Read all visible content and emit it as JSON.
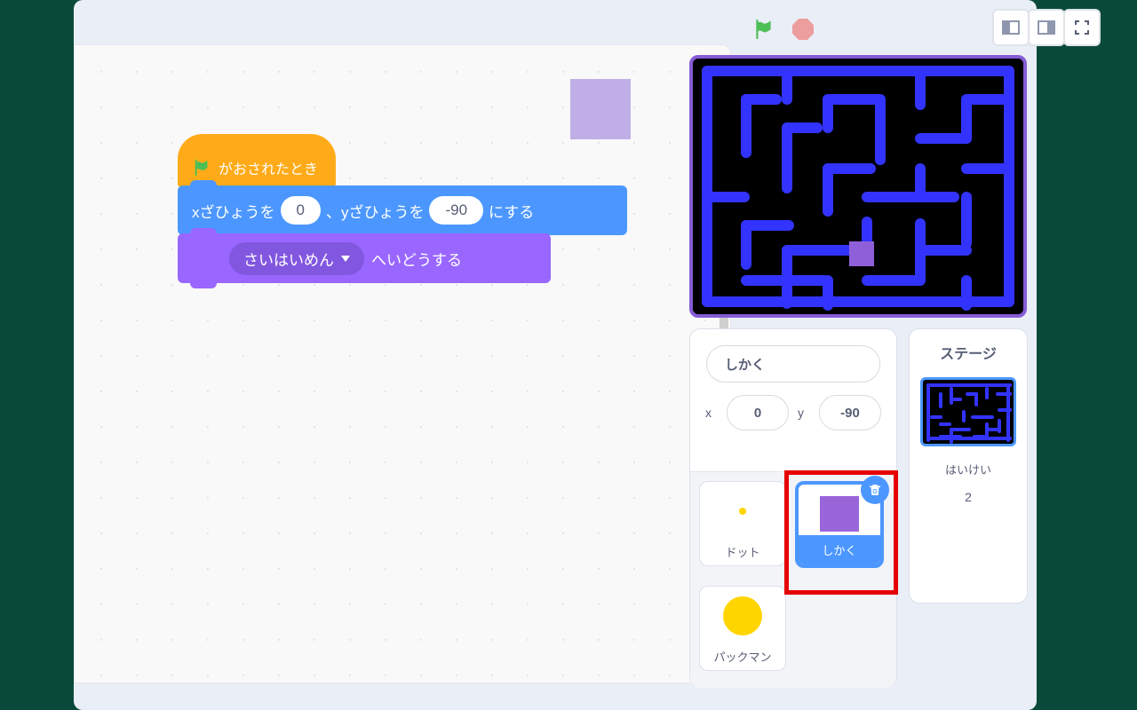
{
  "blocks": {
    "hat_label": "がおされたとき",
    "motion": {
      "prefix": "xざひょうを",
      "x_value": "0",
      "mid": "、yざひょうを",
      "y_value": "-90",
      "suffix": "にする"
    },
    "looks": {
      "dropdown": "さいはいめん",
      "suffix": "へいどうする"
    }
  },
  "sprite_info": {
    "name": "しかく",
    "x_label": "x",
    "x_value": "0",
    "y_label": "y",
    "y_value": "-90"
  },
  "sprites": {
    "dot": "ドット",
    "shikaku": "しかく",
    "pacman": "パックマン"
  },
  "stage_panel": {
    "title": "ステージ",
    "backdrop_label": "はいけい",
    "backdrop_count": "2"
  }
}
